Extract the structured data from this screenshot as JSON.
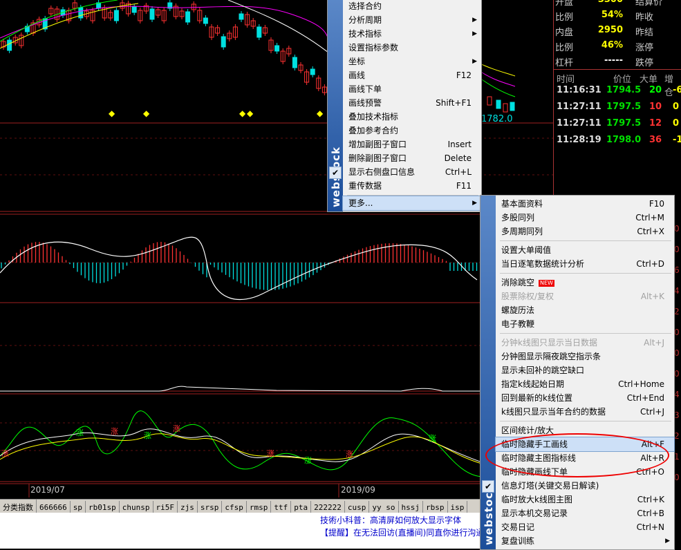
{
  "colors": {
    "up": "#ff3232",
    "down": "#00e0e0",
    "yellow": "#ffff00",
    "green": "#00ff00",
    "white": "#ffffff",
    "magenta": "#ff00ff",
    "grid_red": "#a02020",
    "accent_circle": "#e00000"
  },
  "chart": {
    "price_label": "1782.0",
    "date_labels": [
      "2019/07",
      "2019/09"
    ],
    "rise_marker": "涨",
    "marker_glyph": "◆",
    "right_scale": [
      "0",
      "0",
      "6",
      "4",
      "2",
      "0",
      "0",
      "0",
      "4",
      "3",
      "2",
      "1",
      "0"
    ]
  },
  "quote_panel": {
    "rows": [
      {
        "label": "开盘",
        "value": "3300",
        "value_color": "#ffff00",
        "label2": "结算价"
      },
      {
        "label": "比例",
        "value": "54%",
        "value_color": "#ffff00",
        "label2": "昨收"
      },
      {
        "label": "内盘",
        "value": "2950",
        "value_color": "#ffff00",
        "label2": "昨结"
      },
      {
        "label": "比例",
        "value": "46%",
        "value_color": "#ffff00",
        "label2": "涨停"
      },
      {
        "label": "杠杆",
        "value": "-----",
        "value_color": "#ffffff",
        "label2": "跌停"
      }
    ],
    "ticks_header": {
      "time": "时间",
      "price": "价位",
      "big": "大单",
      "inc": "增仓"
    },
    "ticks": [
      {
        "time": "11:16:31",
        "price": "1794.5",
        "big": "20",
        "big_color": "#00ff00",
        "inc": "-6"
      },
      {
        "time": "11:27:11",
        "price": "1797.5",
        "big": "10",
        "big_color": "#ff3232",
        "inc": "0"
      },
      {
        "time": "11:27:11",
        "price": "1797.5",
        "big": "12",
        "big_color": "#ff3232",
        "inc": "0"
      },
      {
        "time": "11:28:19",
        "price": "1798.0",
        "big": "36",
        "big_color": "#ff3232",
        "inc": "-12"
      }
    ]
  },
  "tabbar": {
    "items": [
      "分类指数",
      "666666",
      "sp",
      "rb01sp",
      "chunsp",
      "ri5F",
      "zjs",
      "srsp",
      "cfsp",
      "rmsp",
      "ttf",
      "pta",
      "222222",
      "cusp",
      "yy so",
      "hssj",
      "rbsp",
      "isp"
    ]
  },
  "info_strip": {
    "line1": "技術小科普：高清屏如何放大显示字体",
    "line2": "【提醒】在无法回访(直播间)同直你进行沟通"
  },
  "menu1": {
    "watermark": "webstock",
    "items": [
      {
        "label": "选择合约",
        "shortcut": "",
        "submenu": false,
        "checked": false
      },
      {
        "label": "分析周期",
        "shortcut": "",
        "submenu": true,
        "checked": false
      },
      {
        "label": "技术指标",
        "shortcut": "",
        "submenu": true,
        "checked": false
      },
      {
        "label": "设置指标参数",
        "shortcut": "",
        "submenu": false,
        "checked": false
      },
      {
        "label": "坐标",
        "shortcut": "",
        "submenu": true,
        "checked": false
      },
      {
        "label": "画线",
        "shortcut": "F12",
        "submenu": false,
        "checked": false
      },
      {
        "label": "画线下单",
        "shortcut": "",
        "submenu": false,
        "checked": false
      },
      {
        "label": "画线预警",
        "shortcut": "Shift+F1",
        "submenu": false,
        "checked": false
      },
      {
        "label": "叠加技术指标",
        "shortcut": "",
        "submenu": false,
        "checked": false
      },
      {
        "label": "叠加参考合约",
        "shortcut": "",
        "submenu": false,
        "checked": false
      },
      {
        "label": "增加副图子窗口",
        "shortcut": "Insert",
        "submenu": false,
        "checked": false
      },
      {
        "label": "删除副图子窗口",
        "shortcut": "Delete",
        "submenu": false,
        "checked": false
      },
      {
        "label": "显示右侧盘口信息",
        "shortcut": "Ctrl+L",
        "submenu": false,
        "checked": true
      },
      {
        "label": "重传数据",
        "shortcut": "F11",
        "submenu": false,
        "checked": false
      }
    ],
    "more": {
      "label": "更多...",
      "submenu": true
    }
  },
  "menu2": {
    "watermark": "webstock",
    "new_badge": "NEW",
    "groups": [
      [
        {
          "label": "基本面资料",
          "shortcut": "F10"
        },
        {
          "label": "多股同列",
          "shortcut": "Ctrl+M"
        },
        {
          "label": "多周期同列",
          "shortcut": "Ctrl+X"
        }
      ],
      [
        {
          "label": "设置大单阈值",
          "shortcut": ""
        },
        {
          "label": "当日逐笔数据统计分析",
          "shortcut": "Ctrl+D"
        }
      ],
      [
        {
          "label": "消除跳空",
          "shortcut": "",
          "badge": true
        },
        {
          "label": "股票除权/复权",
          "shortcut": "Alt+K",
          "disabled": true
        },
        {
          "label": "螺旋历法",
          "shortcut": ""
        },
        {
          "label": "电子教鞭",
          "shortcut": ""
        }
      ],
      [
        {
          "label": "分钟k线图只显示当日数据",
          "shortcut": "Alt+J",
          "disabled": true
        },
        {
          "label": "分钟图显示隔夜跳空指示条",
          "shortcut": ""
        },
        {
          "label": "显示未回补的跳空缺口",
          "shortcut": ""
        },
        {
          "label": "指定k线起始日期",
          "shortcut": "Ctrl+Home"
        },
        {
          "label": "回到最新的k线位置",
          "shortcut": "Ctrl+End"
        },
        {
          "label": "k线图只显示当年合约的数据",
          "shortcut": "Ctrl+J"
        }
      ],
      [
        {
          "label": "区间统计/放大",
          "shortcut": ""
        },
        {
          "label": "临时隐藏手工画线",
          "shortcut": "Alt+F",
          "highlighted": true
        },
        {
          "label": "临时隐藏主图指标线",
          "shortcut": "Alt+R"
        },
        {
          "label": "临时隐藏画线下单",
          "shortcut": "Ctrl+O"
        },
        {
          "label": "信息灯塔(关键交易日解读)",
          "shortcut": "",
          "checked": true
        },
        {
          "label": "临时放大k线图主图",
          "shortcut": "Ctrl+K"
        },
        {
          "label": "显示本机交易记录",
          "shortcut": "Ctrl+B"
        },
        {
          "label": "交易日记",
          "shortcut": "Ctrl+N"
        },
        {
          "label": "复盘训练",
          "shortcut": "",
          "submenu": true
        }
      ]
    ]
  }
}
